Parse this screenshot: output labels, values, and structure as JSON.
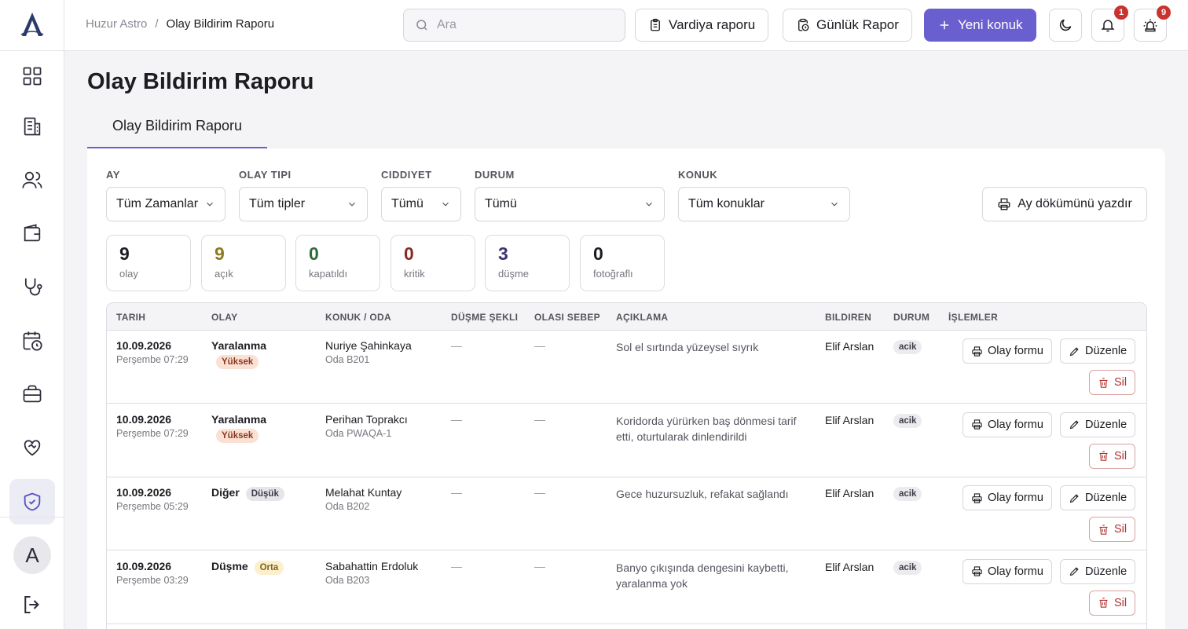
{
  "breadcrumb": {
    "root": "Huzur Astro",
    "sep": "/",
    "current": "Olay Bildirim Raporu"
  },
  "search": {
    "placeholder": "Ara"
  },
  "toolbar": {
    "shift_report": "Vardiya raporu",
    "daily_report": "Günlük Rapor",
    "new_guest": "Yeni konuk",
    "notifications_count": "1",
    "alarms_count": "9"
  },
  "page": {
    "title": "Olay Bildirim Raporu",
    "tab": "Olay Bildirim Raporu"
  },
  "filters": {
    "month": {
      "label": "AY",
      "value": "Tüm Zamanlar"
    },
    "type": {
      "label": "OLAY TIPI",
      "value": "Tüm tipler"
    },
    "severity": {
      "label": "CIDDIYET",
      "value": "Tümü"
    },
    "status": {
      "label": "DURUM",
      "value": "Tümü"
    },
    "guest": {
      "label": "KONUK",
      "value": "Tüm konuklar"
    },
    "print_label": "Ay dökümünü yazdır"
  },
  "stats": [
    {
      "num": "9",
      "label": "olay",
      "color": "#1c1c22"
    },
    {
      "num": "9",
      "label": "açık",
      "color": "#8a7a1e"
    },
    {
      "num": "0",
      "label": "kapatıldı",
      "color": "#2e6b3a"
    },
    {
      "num": "0",
      "label": "kritik",
      "color": "#8a2a24"
    },
    {
      "num": "3",
      "label": "düşme",
      "color": "#3a3470"
    },
    {
      "num": "0",
      "label": "fotoğraflı",
      "color": "#1c1c22"
    }
  ],
  "table": {
    "headers": [
      "TARIH",
      "OLAY",
      "KONUK / ODA",
      "DÜŞME ŞEKLI",
      "OLASI SEBEP",
      "AÇIKLAMA",
      "BILDIREN",
      "DURUM",
      "İŞLEMLER"
    ],
    "rows": [
      {
        "date": "10.09.2026",
        "time": "Perşembe 07:29",
        "type": "Yaralanma",
        "severity": "Yüksek",
        "guest": "Nuriye Şahinkaya",
        "room": "Oda B201",
        "fall": "—",
        "cause": "—",
        "desc": "Sol el sırtında yüzeysel sıyrık",
        "reporter": "Elif Arslan",
        "status": "acik"
      },
      {
        "date": "10.09.2026",
        "time": "Perşembe 07:29",
        "type": "Yaralanma",
        "severity": "Yüksek",
        "guest": "Perihan Toprakcı",
        "room": "Oda PWAQA-1",
        "fall": "—",
        "cause": "—",
        "desc": "Koridorda yürürken baş dönmesi tarif etti, oturtularak dinlendirildi",
        "reporter": "Elif Arslan",
        "status": "acik"
      },
      {
        "date": "10.09.2026",
        "time": "Perşembe 05:29",
        "type": "Diğer",
        "severity": "Düşük",
        "guest": "Melahat Kuntay",
        "room": "Oda B202",
        "fall": "—",
        "cause": "—",
        "desc": "Gece huzursuzluk, refakat sağlandı",
        "reporter": "Elif Arslan",
        "status": "acik"
      },
      {
        "date": "10.09.2026",
        "time": "Perşembe 03:29",
        "type": "Düşme",
        "severity": "Orta",
        "guest": "Sabahattin Erdoluk",
        "room": "Oda B203",
        "fall": "—",
        "cause": "—",
        "desc": "Banyo çıkışında dengesini kaybetti, yaralanma yok",
        "reporter": "Elif Arslan",
        "status": "acik"
      }
    ],
    "actions": {
      "form": "Olay formu",
      "edit": "Düzenle",
      "delete": "Sil"
    }
  },
  "user": {
    "initial": "A"
  }
}
